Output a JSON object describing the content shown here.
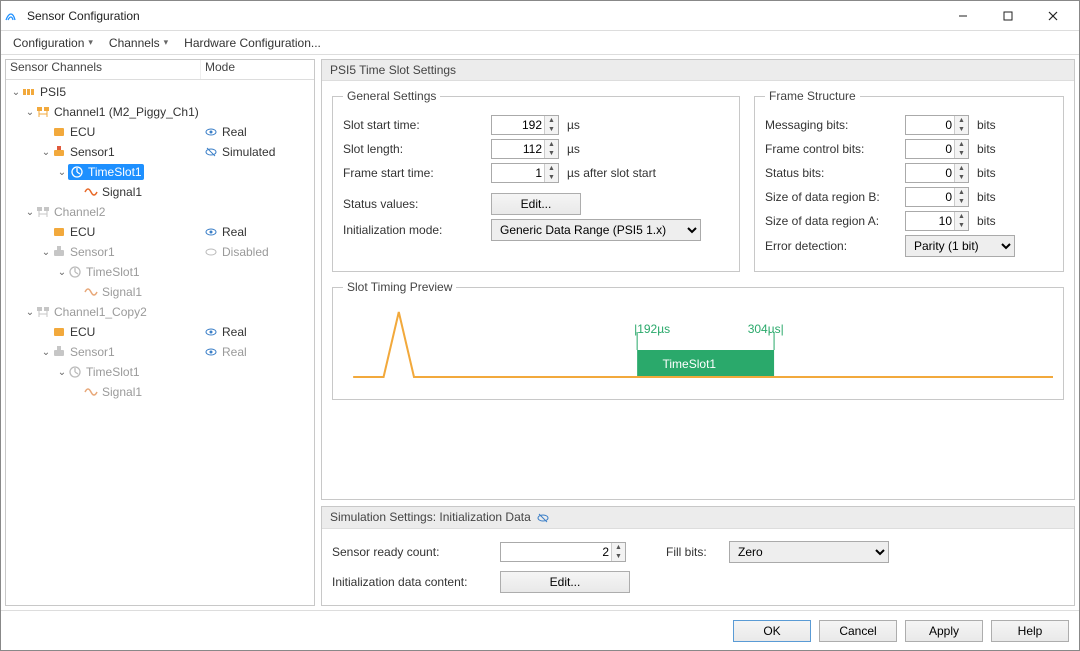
{
  "window": {
    "title": "Sensor Configuration"
  },
  "menu": {
    "items": [
      "Configuration",
      "Channels",
      "Hardware Configuration..."
    ]
  },
  "tree": {
    "headers": {
      "col1": "Sensor Channels",
      "col2": "Mode"
    },
    "root": "PSI5",
    "ch1": {
      "label": "Channel1 (M2_Piggy_Ch1)",
      "ecu": "ECU",
      "ecu_mode": "Real",
      "sensor": "Sensor1",
      "sensor_mode": "Simulated",
      "timeslot": "TimeSlot1",
      "signal": "Signal1"
    },
    "ch2": {
      "label": "Channel2",
      "ecu": "ECU",
      "ecu_mode": "Real",
      "sensor": "Sensor1",
      "sensor_mode": "Disabled",
      "timeslot": "TimeSlot1",
      "signal": "Signal1"
    },
    "ch3": {
      "label": "Channel1_Copy2",
      "ecu": "ECU",
      "ecu_mode": "Real",
      "sensor": "Sensor1",
      "sensor_mode": "Real",
      "timeslot": "TimeSlot1",
      "signal": "Signal1"
    }
  },
  "timeslot": {
    "heading": "PSI5 Time Slot Settings",
    "general": {
      "legend": "General Settings",
      "slot_start_label": "Slot start time:",
      "slot_start": "192",
      "slot_start_unit": "µs",
      "slot_length_label": "Slot length:",
      "slot_length": "112",
      "slot_length_unit": "µs",
      "frame_start_label": "Frame start time:",
      "frame_start": "1",
      "frame_start_unit": "µs after slot start",
      "status_values_label": "Status values:",
      "status_values_btn": "Edit...",
      "init_mode_label": "Initialization mode:",
      "init_mode_value": "Generic Data Range (PSI5 1.x)"
    },
    "frame": {
      "legend": "Frame Structure",
      "msg_bits_label": "Messaging bits:",
      "msg_bits": "0",
      "fc_bits_label": "Frame control bits:",
      "fc_bits": "0",
      "status_bits_label": "Status bits:",
      "status_bits": "0",
      "region_b_label": "Size of data region B:",
      "region_b": "0",
      "region_a_label": "Size of data region A:",
      "region_a": "10",
      "err_det_label": "Error detection:",
      "err_det_value": "Parity (1 bit)",
      "unit": "bits"
    },
    "preview": {
      "legend": "Slot Timing Preview",
      "start_marker": "|192µs",
      "end_marker": "304µs|",
      "slot_name": "TimeSlot1"
    }
  },
  "sim": {
    "heading": "Simulation Settings: Initialization Data",
    "ready_label": "Sensor ready count:",
    "ready_value": "2",
    "fill_label": "Fill bits:",
    "fill_value": "Zero",
    "init_content_label": "Initialization data content:",
    "init_content_btn": "Edit..."
  },
  "footer": {
    "ok": "OK",
    "cancel": "Cancel",
    "apply": "Apply",
    "help": "Help"
  }
}
